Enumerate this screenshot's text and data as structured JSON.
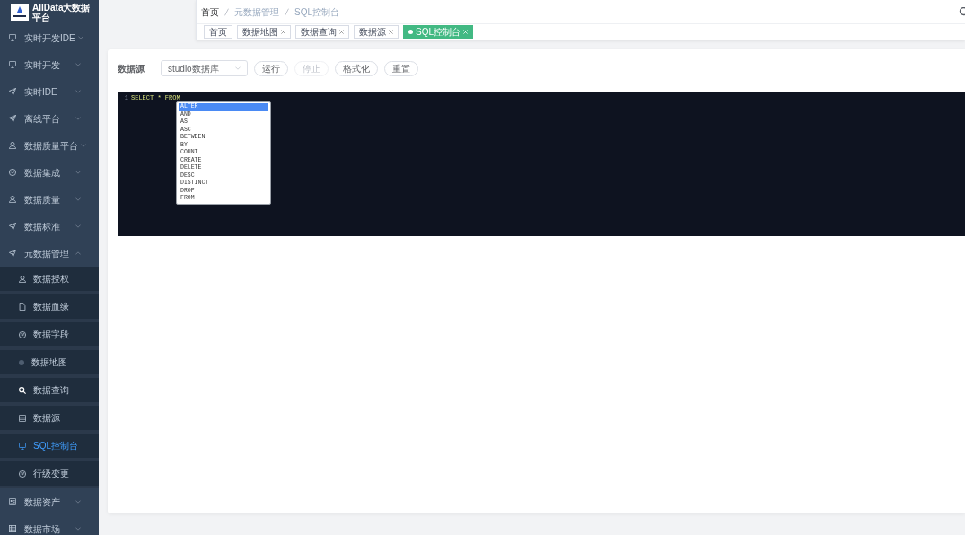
{
  "sidebar": {
    "logo_text": "AllData大数据平台",
    "items": [
      {
        "label": "实时开发IDE",
        "expanded": false
      },
      {
        "label": "实时开发",
        "expanded": false
      },
      {
        "label": "实时IDE",
        "expanded": false
      },
      {
        "label": "离线平台",
        "expanded": false
      },
      {
        "label": "数据质量平台",
        "expanded": false
      },
      {
        "label": "数据集成",
        "expanded": false
      },
      {
        "label": "数据质量",
        "expanded": false
      },
      {
        "label": "数据标准",
        "expanded": false
      },
      {
        "label": "元数据管理",
        "expanded": true,
        "children": [
          {
            "label": "数据授权",
            "selected": false
          },
          {
            "label": "数据血缘",
            "selected": false
          },
          {
            "label": "数据字段",
            "selected": false
          },
          {
            "label": "数据地图",
            "selected": false
          },
          {
            "label": "数据查询",
            "selected": false
          },
          {
            "label": "数据源",
            "selected": false
          },
          {
            "label": "SQL控制台",
            "selected": true
          },
          {
            "label": "行级变更",
            "selected": false
          }
        ]
      },
      {
        "label": "数据资产",
        "expanded": false
      },
      {
        "label": "数据市场",
        "expanded": false
      }
    ]
  },
  "header": {
    "breadcrumb": [
      "首页",
      "元数据管理",
      "SQL控制台"
    ],
    "tags": [
      {
        "label": "首页",
        "selected": false,
        "closable": false
      },
      {
        "label": "数据地图",
        "selected": false,
        "closable": true
      },
      {
        "label": "数据查询",
        "selected": false,
        "closable": true
      },
      {
        "label": "数据源",
        "selected": false,
        "closable": true
      },
      {
        "label": "SQL控制台",
        "selected": true,
        "closable": true
      }
    ]
  },
  "toolbar": {
    "datasource_label": "数据源",
    "datasource_select": {
      "value": "studio数据库"
    },
    "buttons": [
      {
        "label": "运行",
        "disabled": false
      },
      {
        "label": "停止",
        "disabled": true
      },
      {
        "label": "格式化",
        "disabled": false
      },
      {
        "label": "重置",
        "disabled": false
      }
    ]
  },
  "editor": {
    "lines": [
      {
        "number": "1",
        "code": "SELECT * FROM"
      }
    ],
    "autocomplete": [
      {
        "label": "ALTER",
        "selected": true
      },
      {
        "label": "AND",
        "selected": false
      },
      {
        "label": "AS",
        "selected": false
      },
      {
        "label": "ASC",
        "selected": false
      },
      {
        "label": "BETWEEN",
        "selected": false
      },
      {
        "label": "BY",
        "selected": false
      },
      {
        "label": "COUNT",
        "selected": false
      },
      {
        "label": "CREATE",
        "selected": false
      },
      {
        "label": "DELETE",
        "selected": false
      },
      {
        "label": "DESC",
        "selected": false
      },
      {
        "label": "DISTINCT",
        "selected": false
      },
      {
        "label": "DROP",
        "selected": false
      },
      {
        "label": "FROM",
        "selected": false
      }
    ]
  }
}
